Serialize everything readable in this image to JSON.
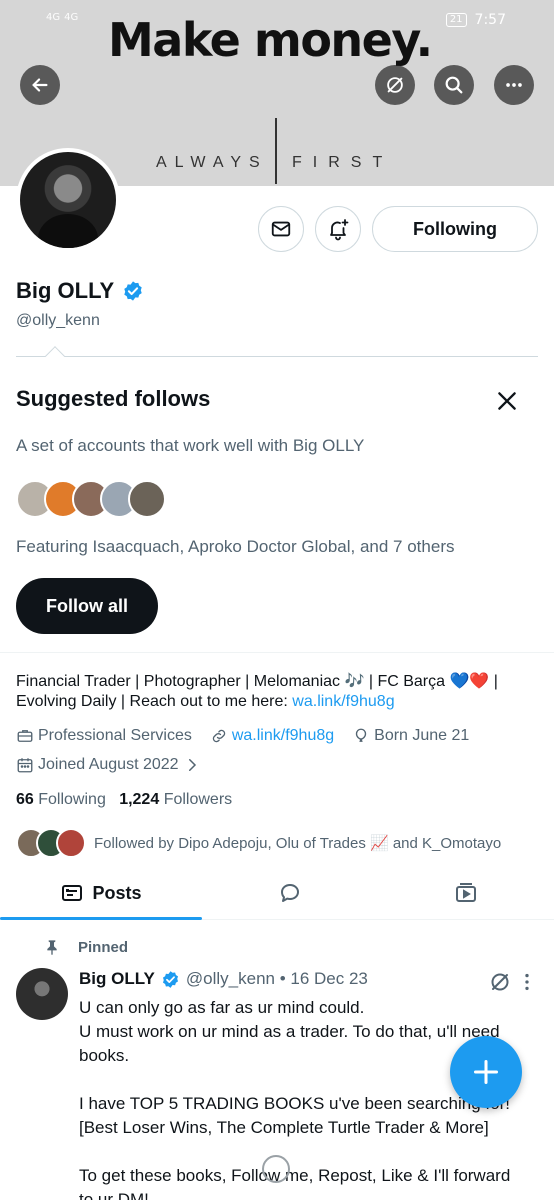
{
  "status_bar": {
    "network_left": [
      "4G",
      "4G"
    ],
    "battery": "21",
    "time": "7:57"
  },
  "banner": {
    "headline": "Make money.",
    "tag_left": "ALWAYS",
    "tag_right": "FIRST"
  },
  "header_icons": {
    "back": "arrow-left-icon",
    "grok": "grok-icon",
    "search": "search-icon",
    "more": "more-icon"
  },
  "profile": {
    "name": "Big OLLY",
    "handle": "@olly_kenn",
    "following_label": "Following",
    "bio_text": "Financial Trader | Photographer | Melomaniac 🎶 | FC Barça 💙❤️ | Evolving Daily | Reach out to me here: ",
    "bio_link": "wa.link/f9hu8g",
    "category": "Professional Services",
    "website": "wa.link/f9hu8g",
    "born": "Born June 21",
    "joined": "Joined August 2022",
    "following_count": "66",
    "following_text": "Following",
    "followers_count": "1,224",
    "followers_text": "Followers",
    "followed_by": "Followed by Dipo Adepoju, Olu of Trades 📈 and K_Omotayo"
  },
  "suggested": {
    "title": "Suggested follows",
    "description": "A set of accounts that work well with Big OLLY",
    "featuring": "Featuring Isaacquach, Aproko Doctor Global, and 7 others",
    "follow_all": "Follow all"
  },
  "tabs": {
    "posts": "Posts"
  },
  "pinned_tweet": {
    "pinned_label": "Pinned",
    "author": "Big OLLY",
    "meta": "@olly_kenn • 16 Dec 23",
    "p1": "U can only go as far as ur mind could.\nU must work on ur mind as a trader. To do that, u'll need books.",
    "p2": "I have TOP 5 TRADING BOOKS u've been searching for! [Best Loser Wins, The Complete Turtle Trader & More]",
    "p3": "To get these books, Follow me, Repost, Like & I'll forward to ur DM!"
  },
  "colors": {
    "accent": "#1d9bf0",
    "text": "#0f1419",
    "muted": "#536471"
  }
}
